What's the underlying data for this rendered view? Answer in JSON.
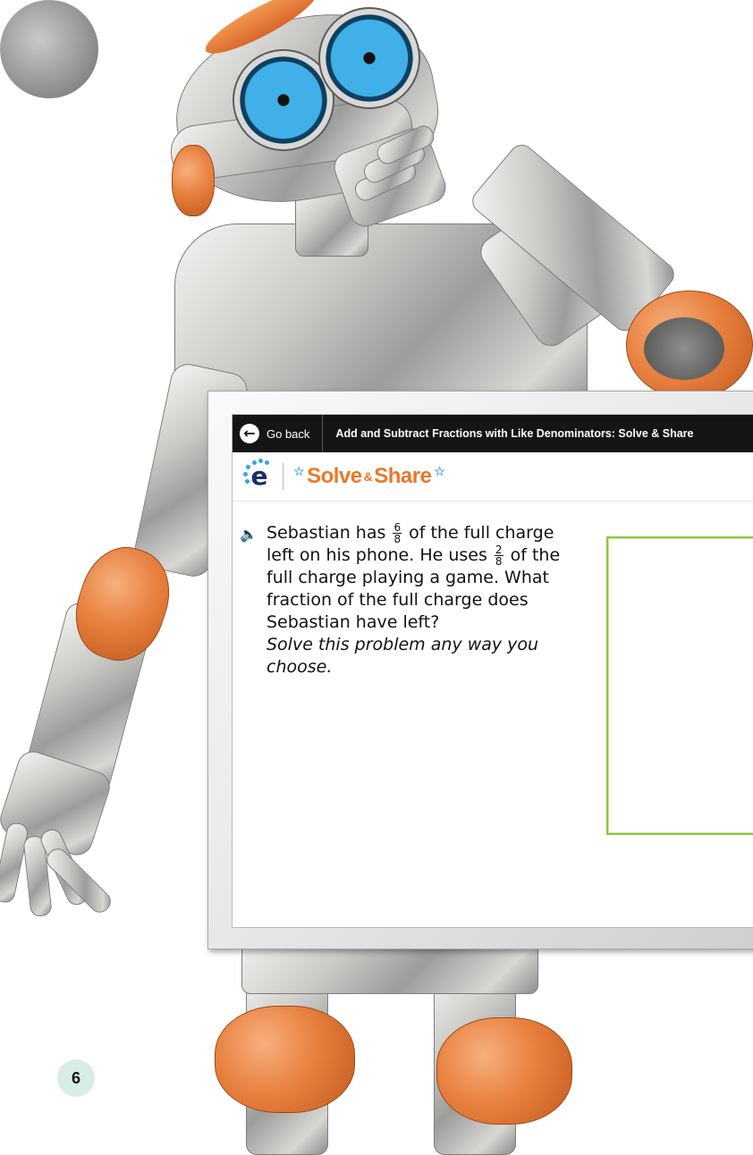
{
  "header": {
    "go_back_label": "Go back",
    "lesson_title": "Add and Subtract Fractions with Like Denominators: Solve & Share"
  },
  "logo": {
    "letter": "e",
    "solve_word": "Solve",
    "amp": "&",
    "share_word": "Share"
  },
  "problem": {
    "part1": "Sebastian has",
    "frac1_num": "6",
    "frac1_den": "8",
    "part2": "of the full charge left on his phone. He uses",
    "frac2_num": "2",
    "frac2_den": "8",
    "part3": "of the full charge playing a game. What fraction of the full charge does Sebastian have left?",
    "instruction": "Solve this problem any way you choose."
  },
  "page_number": "6",
  "colors": {
    "accent_orange": "#e9782a",
    "answer_border": "#8bc63f",
    "topbar": "#151515",
    "speaker_blue": "#2a7fc5"
  },
  "icons": [
    "go-back-arrow-icon",
    "speaker-icon",
    "star-icon"
  ]
}
